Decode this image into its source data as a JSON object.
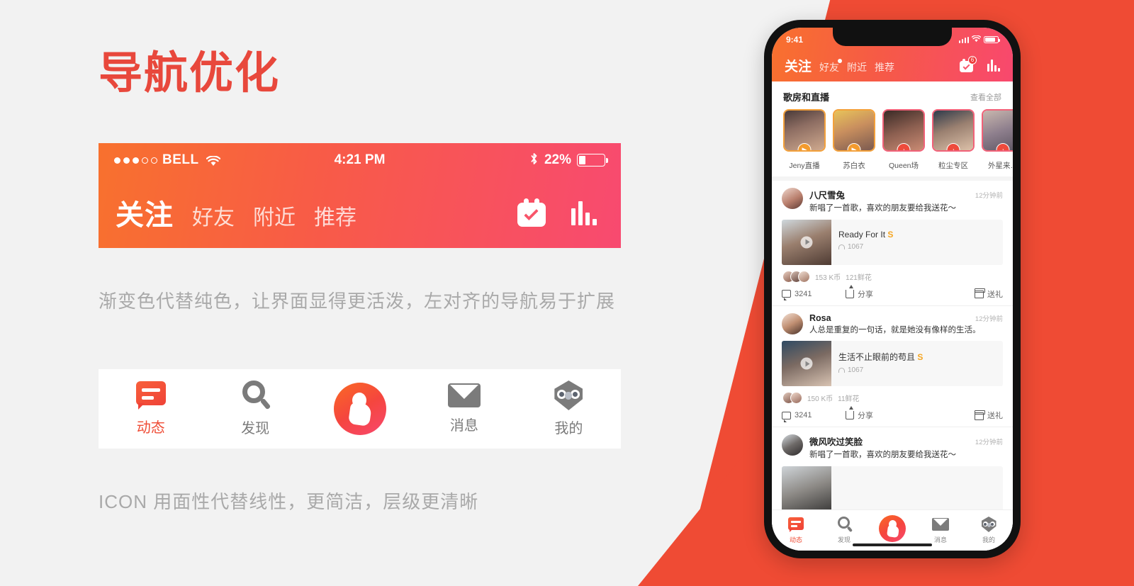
{
  "page": {
    "title": "导航优化",
    "caption_nav": "渐变色代替纯色，让界面显得更活泼，左对齐的导航易于扩展",
    "caption_icon": "ICON 用面性代替线性，更简洁，层级更清晰",
    "accent_color": "#ef4b34",
    "gradient_start": "#f8712e",
    "gradient_end": "#f8486e"
  },
  "nav_demo": {
    "status": {
      "carrier": "BELL",
      "time": "4:21 PM",
      "battery_percent": "22%",
      "signal_filled": 3,
      "signal_empty": 2,
      "wifi_icon": "wifi-icon",
      "bluetooth_icon": "bluetooth-icon"
    },
    "tabs": [
      {
        "label": "关注",
        "active": true
      },
      {
        "label": "好友",
        "active": false
      },
      {
        "label": "附近",
        "active": false
      },
      {
        "label": "推荐",
        "active": false
      }
    ],
    "actions": [
      {
        "icon": "calendar-check-icon"
      },
      {
        "icon": "rank-bars-icon"
      }
    ]
  },
  "tabbar_demo": {
    "items": [
      {
        "label": "动态",
        "icon": "speech-bubble-icon",
        "active": true
      },
      {
        "label": "发现",
        "icon": "search-icon",
        "active": false
      },
      {
        "label": "",
        "icon": "mic-record-icon",
        "active": false
      },
      {
        "label": "消息",
        "icon": "mail-icon",
        "active": false
      },
      {
        "label": "我的",
        "icon": "owl-profile-icon",
        "active": false
      }
    ]
  },
  "phone": {
    "status": {
      "time": "9:41",
      "signal_icon": "cellular-signal-icon",
      "wifi_icon": "wifi-icon",
      "battery_icon": "battery-icon"
    },
    "nav": {
      "tabs": [
        {
          "label": "关注",
          "active": true,
          "badge": false
        },
        {
          "label": "好友",
          "active": false,
          "badge": true
        },
        {
          "label": "附近",
          "active": false,
          "badge": false
        },
        {
          "label": "推荐",
          "active": false,
          "badge": false
        }
      ],
      "calendar_badge": "6",
      "actions": [
        {
          "icon": "calendar-check-icon"
        },
        {
          "icon": "rank-bars-icon"
        }
      ]
    },
    "live_section": {
      "title": "歌房和直播",
      "more_label": "查看全部",
      "cards": [
        {
          "name": "Jeny直播",
          "badge": "video",
          "color": "#f3a03a"
        },
        {
          "name": "苏白衣",
          "badge": "video",
          "color": "#f3a03a"
        },
        {
          "name": "Queen场",
          "badge": "mic",
          "color": "#f16178"
        },
        {
          "name": "粒尘专区",
          "badge": "mic",
          "color": "#f16178"
        },
        {
          "name": "外星来…",
          "badge": "mic",
          "color": "#f16178"
        }
      ]
    },
    "feed": [
      {
        "name": "八尺雪兔",
        "time": "12分钟前",
        "text": "新唱了一首歌，喜欢的朋友要给我送花～",
        "song_title": "Ready For It",
        "song_mark": "S",
        "plays": "1067",
        "coins": "153 K币",
        "flowers": "121鲜花",
        "comments": "3241",
        "share_label": "分享",
        "gift_label": "送礼",
        "like_avatar_count": 3
      },
      {
        "name": "Rosa",
        "time": "12分钟前",
        "text": "人总是重复的一句话，就是她没有像样的生活。",
        "song_title": "生活不止眼前的苟且",
        "song_mark": "S",
        "plays": "1067",
        "coins": "150 K币",
        "flowers": "11鲜花",
        "comments": "3241",
        "share_label": "分享",
        "gift_label": "送礼",
        "like_avatar_count": 2
      },
      {
        "name": "微风吹过笑脸",
        "time": "12分钟前",
        "text": "新唱了一首歌，喜欢的朋友要给我送花～",
        "song_title": "",
        "song_mark": "",
        "plays": "",
        "coins": "",
        "flowers": "",
        "comments": "",
        "share_label": "",
        "gift_label": "",
        "like_avatar_count": 0
      }
    ],
    "tabbar": {
      "items": [
        {
          "label": "动态",
          "icon": "speech-bubble-icon",
          "active": true
        },
        {
          "label": "发现",
          "icon": "search-icon",
          "active": false
        },
        {
          "label": "",
          "icon": "mic-record-icon",
          "active": false
        },
        {
          "label": "消息",
          "icon": "mail-icon",
          "active": false
        },
        {
          "label": "我的",
          "icon": "owl-profile-icon",
          "active": false
        }
      ]
    }
  }
}
